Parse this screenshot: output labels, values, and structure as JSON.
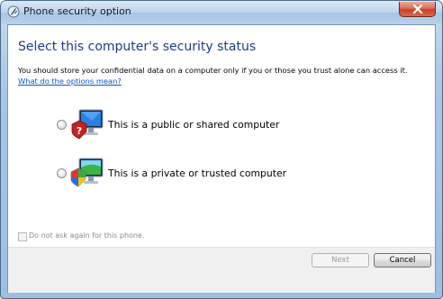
{
  "window": {
    "title": "Phone security option"
  },
  "main": {
    "heading": "Select this computer's security status",
    "description": "You should store your confidential data on a computer only if you or those you trust alone can access it.",
    "help_link": "What do the options mean?"
  },
  "options": [
    {
      "label": "This is a public or shared computer",
      "icon": "shared-computer-warning-icon",
      "selected": false
    },
    {
      "label": "This is a private or trusted computer",
      "icon": "trusted-computer-shield-icon",
      "selected": false
    }
  ],
  "checkbox": {
    "label": "Do not ask again for this phone.",
    "checked": false,
    "enabled": false
  },
  "buttons": {
    "next": "Next",
    "cancel": "Cancel"
  },
  "colors": {
    "heading": "#1e3a8a",
    "link": "#0b56c6",
    "close_button": "#c7402a"
  }
}
